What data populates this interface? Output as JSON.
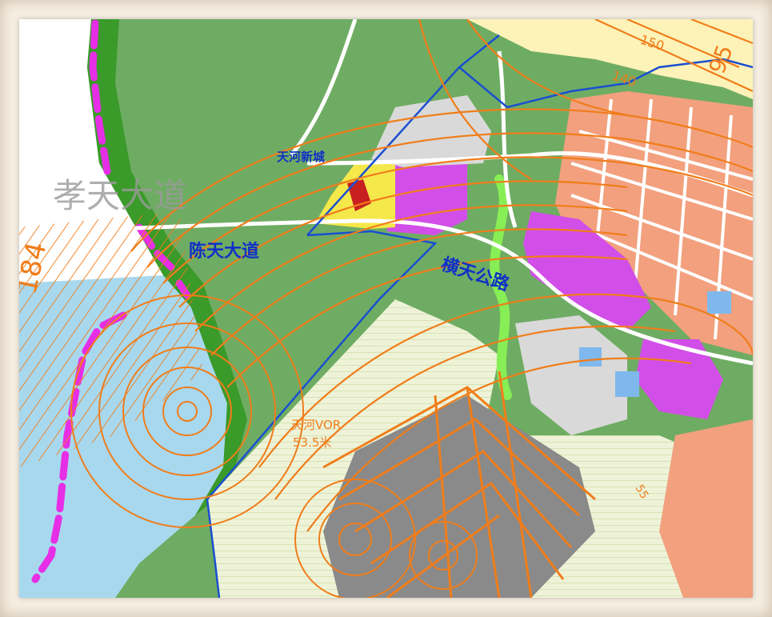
{
  "map": {
    "labels": {
      "tianhe_xincheng": "天河新城",
      "chentian_dadao": "陈天大道",
      "hengtian_gonglu": "横天公路",
      "xiaotian_dadao": "孝天大道",
      "vor_station": "天河VOR",
      "vor_height": "53.5米",
      "contour_184": "184",
      "contour_150": "150",
      "contour_140": "140",
      "contour_95": "95",
      "contour_55": "55"
    },
    "colors": {
      "water": "#a8d8ee",
      "greenbelt": "#3a9a2a",
      "farmland": "#6fac63",
      "boundary": "#1a4fd0",
      "airspace_line": "#f07d1a",
      "residential": "#f2a07e",
      "commercial": "#d24ee8",
      "industrial_yellow": "#f5e84a",
      "airport_runway": "#8a8a8a",
      "magenta_shore": "#e62ee6",
      "road": "#ffffff",
      "airport_zone": "#e8f0cf"
    }
  }
}
